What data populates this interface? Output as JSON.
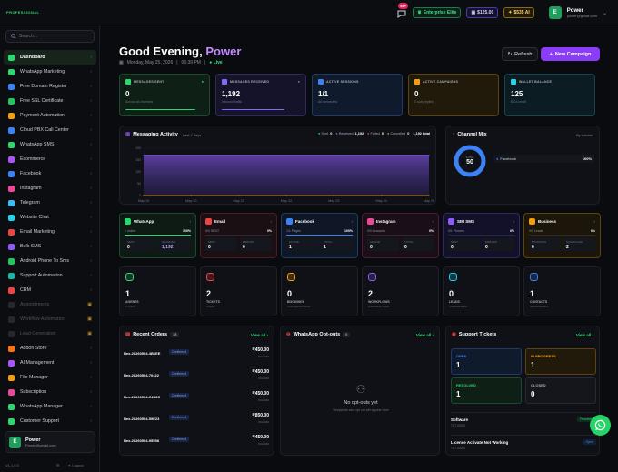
{
  "brand": "PROFESSIONAL",
  "topbar": {
    "notif_count": "99+",
    "enterprise": "Enterprise Elite",
    "balance": "$125.00",
    "ai_credits": "$535 AI",
    "user_name": "Power",
    "user_email": "power@gmail.com",
    "avatar_letter": "E"
  },
  "sidebar": {
    "search_placeholder": "Search...",
    "items": [
      {
        "label": "Dashboard",
        "color": "#2bd86f"
      },
      {
        "label": "WhatsApp Marketing",
        "color": "#2bd86f"
      },
      {
        "label": "Free Domain Register",
        "color": "#3b82f6"
      },
      {
        "label": "Free SSL Certificate",
        "color": "#22c55e"
      },
      {
        "label": "Payment Automation",
        "color": "#f59e0b"
      },
      {
        "label": "Cloud PBX Call Center",
        "color": "#3b82f6"
      },
      {
        "label": "WhatsApp SMS",
        "color": "#2bd86f"
      },
      {
        "label": "Ecommerce",
        "color": "#a855f7"
      },
      {
        "label": "Facebook",
        "color": "#3b82f6"
      },
      {
        "label": "Instagram",
        "color": "#ec4899"
      },
      {
        "label": "Telegram",
        "color": "#38bdf8"
      },
      {
        "label": "Website Chat",
        "color": "#22d3ee"
      },
      {
        "label": "Email Marketing",
        "color": "#ef4444"
      },
      {
        "label": "Bulk SMS",
        "color": "#8b5cf6"
      },
      {
        "label": "Android Phone To Sms",
        "color": "#22c55e"
      },
      {
        "label": "Support Automation",
        "color": "#14b8a6"
      },
      {
        "label": "CRM",
        "color": "#ef4444"
      },
      {
        "label": "Appointments",
        "color": "#4d525e",
        "locked": true
      },
      {
        "label": "Workflow Automation",
        "color": "#4d525e",
        "locked": true
      },
      {
        "label": "Lead Generation",
        "color": "#4d525e",
        "locked": true
      },
      {
        "label": "Addon Store",
        "color": "#f97316"
      },
      {
        "label": "AI Management",
        "color": "#a855f7"
      },
      {
        "label": "File Manager",
        "color": "#f59e0b"
      },
      {
        "label": "Subscription",
        "color": "#ec4899"
      },
      {
        "label": "WhatsApp Manager",
        "color": "#2bd86f"
      },
      {
        "label": "Customer Support",
        "color": "#2bd86f"
      }
    ],
    "user_name": "Power",
    "user_email": "Power@gmail.com",
    "version": "V1.1.0.0",
    "logout": "Logout"
  },
  "header": {
    "greeting": "Good Evening,",
    "name": "Power",
    "date": "Monday, May 25, 2026",
    "time": "06:39 PM",
    "live": "Live",
    "refresh": "Refresh",
    "new_campaign": "New Campaign"
  },
  "stats": [
    {
      "label": "MESSAGES SENT",
      "value": "0",
      "sub": "Across all channels",
      "color": "#2bd86f",
      "bg": "#0e1f16",
      "border": "#1c4a30",
      "progress": 0.9
    },
    {
      "label": "MESSAGES RECEIVED",
      "value": "1,192",
      "sub": "Inbound traffic",
      "color": "#7c6cf6",
      "bg": "#14132a",
      "border": "#2e2a5c",
      "progress": 0.8
    },
    {
      "label": "ACTIVE SESSIONS",
      "value": "1/1",
      "sub": "All connected",
      "color": "#3b82f6",
      "bg": "#0f1a2c",
      "border": "#1f3a66",
      "progress": 0
    },
    {
      "label": "ACTIVE CAMPAIGNS",
      "value": "0",
      "sub": "0 auto replies",
      "color": "#f59e0b",
      "bg": "#211a0a",
      "border": "#5a4412",
      "progress": 0
    },
    {
      "label": "WALLET BALANCE",
      "value": "125",
      "sub": "$114 credit",
      "color": "#22d3ee",
      "bg": "#0b1d22",
      "border": "#17464f",
      "progress": 0
    }
  ],
  "activity": {
    "title": "Messaging Activity",
    "period": "Last 7 days",
    "legend": [
      {
        "label": "Sent",
        "value": "0",
        "color": "#2bd86f"
      },
      {
        "label": "Received",
        "value": "1,192",
        "color": "#8b5cf6"
      },
      {
        "label": "Failed",
        "value": "0",
        "color": "#ef4444"
      },
      {
        "label": "Cancelled",
        "value": "0",
        "color": "#f59e0b"
      }
    ],
    "total": "1,192 total"
  },
  "chart_data": {
    "type": "area",
    "x": [
      "May 19",
      "May 20",
      "May 21",
      "May 22",
      "May 23",
      "May 24",
      "May 25"
    ],
    "yticks": [
      "200",
      "150",
      "100",
      "50",
      "0"
    ],
    "ylim": [
      0,
      200
    ],
    "series": [
      {
        "name": "Received",
        "values": [
          170,
          170,
          170,
          170,
          170,
          170,
          170
        ],
        "color": "#8b5cf6"
      },
      {
        "name": "Sent",
        "values": [
          0,
          0,
          0,
          0,
          0,
          0,
          0
        ],
        "color": "#f59e0b"
      }
    ]
  },
  "channel_mix": {
    "title": "Channel Mix",
    "by": "By volume",
    "total_label": "TOTAL",
    "total": "50",
    "item": "Facebook",
    "item_pct": "100%"
  },
  "channels": [
    {
      "name": "WhatsApp",
      "status": "1 online",
      "pct": "100%",
      "a_lbl": "SENT",
      "a": "0",
      "b_lbl": "RECEIVED",
      "b": "1,192",
      "color": "#2bd86f",
      "bg": "#0e1a14",
      "border": "#1c4a30"
    },
    {
      "name": "Email",
      "status": "0/0 SENT",
      "pct": "0%",
      "a_lbl": "SENT",
      "a": "0",
      "b_lbl": "ERRORS",
      "b": "0",
      "color": "#ef4444",
      "bg": "#1a0f12",
      "border": "#4a1c24"
    },
    {
      "name": "Facebook",
      "status": "1/1 Pages",
      "pct": "100%",
      "a_lbl": "ACTIVE",
      "a": "1",
      "b_lbl": "TOTAL",
      "b": "1",
      "color": "#3b82f6",
      "bg": "#0f1626",
      "border": "#1f3a66"
    },
    {
      "name": "Instagram",
      "status": "0/0 Accounts",
      "pct": "0%",
      "a_lbl": "ACTIVE",
      "a": "0",
      "b_lbl": "TOTAL",
      "b": "0",
      "color": "#ec4899",
      "bg": "#1a0f18",
      "border": "#4a1c3c"
    },
    {
      "name": "SIM SMS",
      "status": "0/1 Phones",
      "pct": "0%",
      "a_lbl": "SENT",
      "a": "0",
      "b_lbl": "ERRORS",
      "b": "0",
      "color": "#8b5cf6",
      "bg": "#13112a",
      "border": "#2e2a5c"
    },
    {
      "name": "Business",
      "status": "0/0 Leads",
      "pct": "0%",
      "a_lbl": "BOOKINGS",
      "a": "0",
      "b_lbl": "SCHEDULED",
      "b": "2",
      "color": "#f59e0b",
      "bg": "#1c160a",
      "border": "#5a4412"
    }
  ],
  "kpis": [
    {
      "value": "1",
      "label": "AGENTS",
      "sub": "1 online",
      "color": "#2bd86f"
    },
    {
      "value": "2",
      "label": "TICKETS",
      "sub": "2 open",
      "color": "#ef4444"
    },
    {
      "value": "0",
      "label": "BOOKINGS",
      "sub": "Total appointments",
      "color": "#f59e0b"
    },
    {
      "value": "2",
      "label": "WORKFLOWS",
      "sub": "Automation flows",
      "color": "#8b5cf6"
    },
    {
      "value": "0",
      "label": "LEADS",
      "sub": "Captured leads",
      "color": "#22d3ee"
    },
    {
      "value": "1",
      "label": "CONTACTS",
      "sub": "Saved contacts",
      "color": "#3b82f6"
    }
  ],
  "orders": {
    "title": "Recent Orders",
    "count": "15",
    "view_all": "View all",
    "rows": [
      {
        "id": "Nex-20260504-4B1EE",
        "status": "Confirmed",
        "amount": "₹450.00",
        "date": "5/4/2026"
      },
      {
        "id": "Nex-20260504-70422",
        "status": "Confirmed",
        "amount": "₹450.00",
        "date": "5/4/2026"
      },
      {
        "id": "Nex-20260504-C233C",
        "status": "Confirmed",
        "amount": "₹450.00",
        "date": "5/4/2026"
      },
      {
        "id": "Nex-20260504-59E23",
        "status": "Confirmed",
        "amount": "₹850.00",
        "date": "5/4/2026"
      },
      {
        "id": "Nex-20260504-95558",
        "status": "Confirmed",
        "amount": "₹450.00",
        "date": "5/4/2026"
      }
    ]
  },
  "optouts": {
    "title": "WhatsApp Opt-outs",
    "count": "0",
    "view_all": "View all",
    "empty": "No opt-outs yet",
    "empty_sub": "Recipients who opt out will appear here"
  },
  "tickets": {
    "title": "Support Tickets",
    "view_all": "View all",
    "boxes": [
      {
        "label": "OPEN",
        "value": "1",
        "color": "#3b82f6",
        "bg": "#0f1a2c",
        "border": "#1f3a66"
      },
      {
        "label": "IN PROGRESS",
        "value": "1",
        "color": "#f59e0b",
        "bg": "#211a0a",
        "border": "#5a4412"
      },
      {
        "label": "RESOLVED",
        "value": "1",
        "color": "#2bd86f",
        "bg": "#0e1f16",
        "border": "#1c4a30"
      },
      {
        "label": "CLOSED",
        "value": "0",
        "color": "#aab",
        "bg": "#14161c",
        "border": "#262a34"
      }
    ],
    "items": [
      {
        "title": "Software",
        "sub": "TKT-00002",
        "badge": "Resolved",
        "badge_color": "#2bd86f"
      },
      {
        "title": "License Activate Not Working",
        "sub": "TKT-00001",
        "badge": "Open",
        "badge_color": "#3b82f6"
      }
    ]
  }
}
